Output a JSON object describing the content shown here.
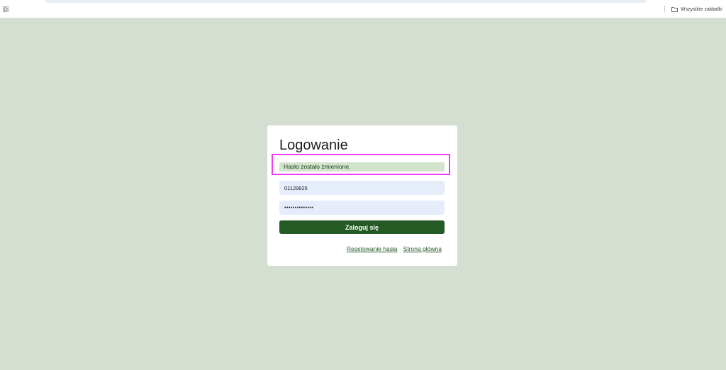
{
  "browser": {
    "bookmarks_label": "Wszystkie zakładki"
  },
  "login": {
    "title": "Logowanie",
    "alert_message": "Hasło zostało zmienione.",
    "login_value": "01129825",
    "password_value": "••••••••••••••",
    "submit_label": "Zaloguj się",
    "links": {
      "reset_password": "Resetowanie hasła",
      "home": "Strona główna"
    }
  },
  "colors": {
    "page_background": "#d4dfd2",
    "primary": "#245a24",
    "alert_background": "#d2e4cc",
    "input_background": "#e4edf9",
    "highlight": "#f03ef0"
  }
}
